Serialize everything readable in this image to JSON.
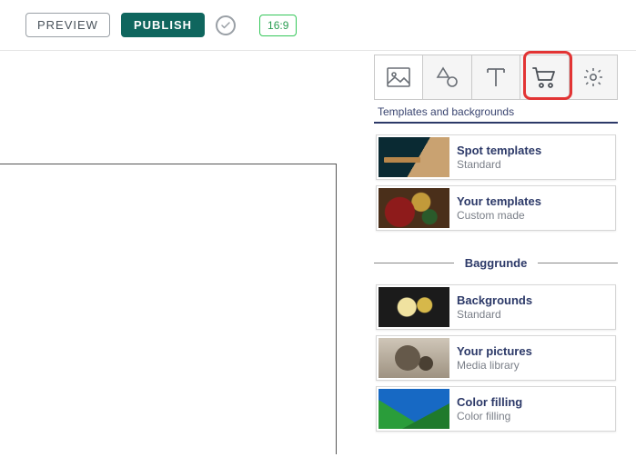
{
  "topbar": {
    "preview_label": "PREVIEW",
    "publish_label": "PUBLISH",
    "aspect_label": "16:9"
  },
  "panel": {
    "title": "Templates and backgrounds",
    "section_backgrounds_label": "Baggrunde",
    "cards": {
      "spot_templates": {
        "title": "Spot templates",
        "sub": "Standard"
      },
      "your_templates": {
        "title": "Your templates",
        "sub": "Custom made"
      },
      "backgrounds": {
        "title": "Backgrounds",
        "sub": "Standard"
      },
      "your_pictures": {
        "title": "Your pictures",
        "sub": "Media library"
      },
      "color_filling": {
        "title": "Color filling",
        "sub": "Color filling"
      }
    }
  },
  "tools": {
    "image": "image-icon",
    "shapes": "shapes-icon",
    "text": "text-icon",
    "cart": "cart-icon",
    "settings": "gear-icon"
  }
}
